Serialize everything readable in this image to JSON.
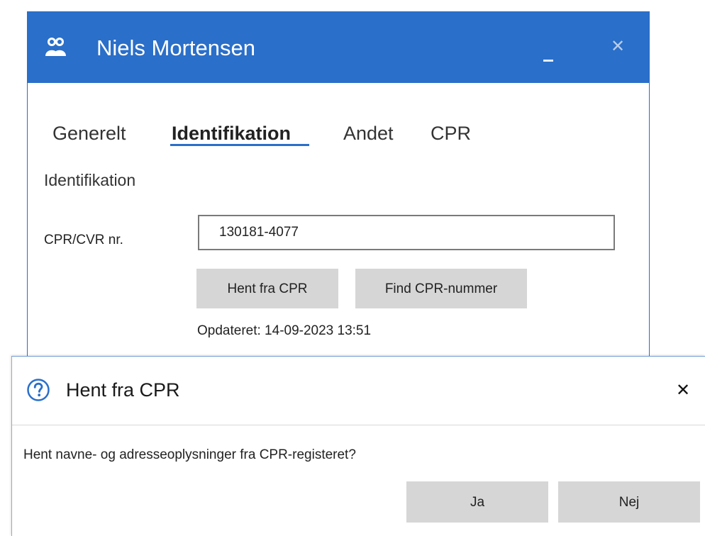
{
  "window": {
    "title": "Niels Mortensen",
    "accent_color": "#2a6fc9",
    "icon": "user-group-icon"
  },
  "tabs": [
    {
      "label": "Generelt",
      "active": false
    },
    {
      "label": "Identifikation",
      "active": true
    },
    {
      "label": "Andet",
      "active": false
    },
    {
      "label": "CPR",
      "active": false
    }
  ],
  "identification": {
    "heading": "Identifikation",
    "cpr_label": "CPR/CVR nr.",
    "cpr_value": "130181-4077",
    "fetch_button": "Hent fra CPR",
    "find_button": "Find CPR-nummer",
    "updated_text": "Opdateret: 14-09-2023 13:51"
  },
  "dialog": {
    "icon": "question-icon",
    "title": "Hent fra CPR",
    "close_glyph": "✕",
    "message": "Hent navne- og adresseoplysninger fra CPR-registeret?",
    "yes_button": "Ja",
    "no_button": "Nej"
  }
}
